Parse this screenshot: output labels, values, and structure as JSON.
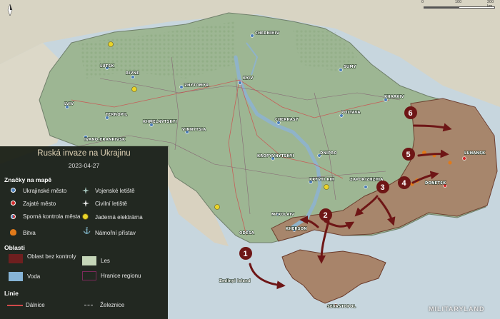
{
  "legend": {
    "title": "Ruská invaze na Ukrajinu",
    "date": "2023-04-27",
    "markers_heading": "Značky na mapě",
    "markers": {
      "ukr_city": "Ukrajinské město",
      "captured_city": "Zajaté město",
      "contested_city": "Sporná kontrola města",
      "battle": "Bitva",
      "military_airport": "Vojenské letiště",
      "civil_airport": "Civilní letiště",
      "nuclear_plant": "Jaderná elektrárna",
      "naval_port": "Námořní přístav"
    },
    "areas_heading": "Oblasti",
    "areas": {
      "uncontrolled": "Oblast bez kontroly",
      "forest": "Les",
      "water": "Voda",
      "region_border": "Hranice regionu"
    },
    "lines_heading": "Linie",
    "lines": {
      "highway": "Dálnice",
      "railway": "Železnice"
    }
  },
  "scale": {
    "labels": [
      "0",
      "100",
      "200 km"
    ]
  },
  "logo": "MILITARYLAND",
  "cities": {
    "chernihiv": "CHERNIHIV",
    "sumy": "SUMY",
    "kyiv": "KYIV",
    "lutsk": "LUTSK",
    "rivne": "RIVNE",
    "zhytomyr": "ZHYTOMYR",
    "lviv": "LVIV",
    "ternopil": "TERNOPIL",
    "khmelnytskyi": "KHMELNYTSKYI",
    "vinnytsia": "VINNYTSIA",
    "ivano_frankivsk": "IVANO-FRANKIVSK",
    "cherkasy": "CHERKASY",
    "poltava": "POLTAVA",
    "kharkiv": "KHARKIV",
    "kropyvnytskyi": "KROPYVNYTSKYI",
    "dnipro": "DNIPRO",
    "luhansk": "LUHANSK",
    "donetsk": "DONETSK",
    "zaporizhzhia": "ZAPORIZHZHIA",
    "kryvyi_rih": "KRYVYI RIH",
    "mykolaiv": "MYKOLAIV",
    "kherson": "KHERSON",
    "odesa": "ODESA",
    "zmiinyi": "Zmiinyi Island",
    "sevastopol": "SEVASTOPOL"
  },
  "arrows": [
    "1",
    "2",
    "3",
    "4",
    "5",
    "6"
  ],
  "colors": {
    "land": "#9db693",
    "occupied": "#a8846a",
    "water": "#c7d6de",
    "arrow": "#6e1616",
    "legend_bg": "#161b12"
  }
}
